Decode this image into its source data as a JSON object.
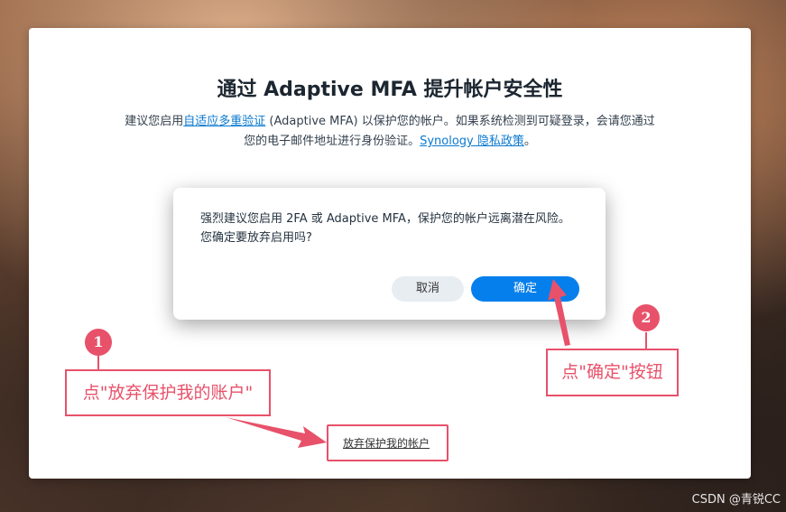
{
  "page": {
    "title": "通过 Adaptive MFA 提升帐户安全性",
    "description": {
      "part1": "建议您启用",
      "link1": "自适应多重验证",
      "part2": " (Adaptive MFA) 以保护您的帐户。如果系统检测到可疑登录，会请您通过您的电子邮件地址进行身份验证。",
      "link2": "Synology 隐私政策",
      "part3": "。"
    },
    "give_up_link": "放弃保护我的帐户"
  },
  "dialog": {
    "line1": "强烈建议您启用 2FA 或 Adaptive MFA，保护您的帐户远离潜在风险。",
    "line2": "您确定要放弃启用吗?",
    "cancel_label": "取消",
    "ok_label": "确定"
  },
  "annotations": {
    "step1": {
      "number": "1",
      "text": "点\"放弃保护我的账户\""
    },
    "step2": {
      "number": "2",
      "text": "点\"确定\"按钮"
    },
    "color": "#e8516a"
  },
  "watermark": "CSDN @青锐CC",
  "colors": {
    "primary_button": "#057feb",
    "link": "#0b79d0"
  }
}
